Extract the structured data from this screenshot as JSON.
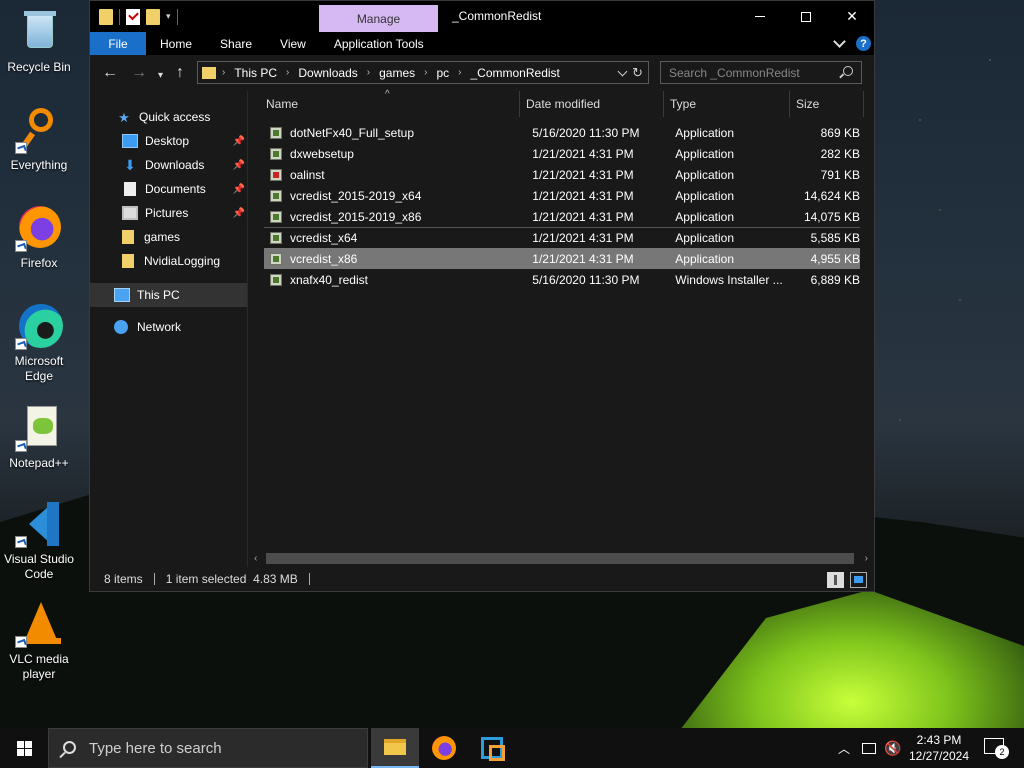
{
  "desktop": {
    "icons": [
      {
        "label": "Recycle Bin"
      },
      {
        "label": "Everything"
      },
      {
        "label": "Firefox"
      },
      {
        "label": "Microsoft Edge"
      },
      {
        "label": "Notepad++"
      },
      {
        "label": "Visual Studio Code"
      },
      {
        "label": "VLC media player"
      }
    ]
  },
  "window": {
    "title": "_CommonRedist",
    "manage_tab": "Manage",
    "ribbon_tabs": [
      "File",
      "Home",
      "Share",
      "View",
      "Application Tools"
    ],
    "help_label": "?",
    "breadcrumbs": [
      "This PC",
      "Downloads",
      "games",
      "pc",
      "_CommonRedist"
    ],
    "search_placeholder": "Search _CommonRedist"
  },
  "nav": {
    "items": [
      {
        "label": "Quick access"
      },
      {
        "label": "Desktop"
      },
      {
        "label": "Downloads"
      },
      {
        "label": "Documents"
      },
      {
        "label": "Pictures"
      },
      {
        "label": "games"
      },
      {
        "label": "NvidiaLogging"
      },
      {
        "label": "This PC"
      },
      {
        "label": "Network"
      }
    ]
  },
  "files": {
    "columns": [
      "Name",
      "Date modified",
      "Type",
      "Size"
    ],
    "rows": [
      {
        "name": "dotNetFx40_Full_setup",
        "date": "5/16/2020 11:30 PM",
        "type": "Application",
        "size": "869 KB"
      },
      {
        "name": "dxwebsetup",
        "date": "1/21/2021 4:31 PM",
        "type": "Application",
        "size": "282 KB"
      },
      {
        "name": "oalinst",
        "date": "1/21/2021 4:31 PM",
        "type": "Application",
        "size": "791 KB"
      },
      {
        "name": "vcredist_2015-2019_x64",
        "date": "1/21/2021 4:31 PM",
        "type": "Application",
        "size": "14,624 KB"
      },
      {
        "name": "vcredist_2015-2019_x86",
        "date": "1/21/2021 4:31 PM",
        "type": "Application",
        "size": "14,075 KB"
      },
      {
        "name": "vcredist_x64",
        "date": "1/21/2021 4:31 PM",
        "type": "Application",
        "size": "5,585 KB"
      },
      {
        "name": "vcredist_x86",
        "date": "1/21/2021 4:31 PM",
        "type": "Application",
        "size": "4,955 KB"
      },
      {
        "name": "xnafx40_redist",
        "date": "5/16/2020 11:30 PM",
        "type": "Windows Installer ...",
        "size": "6,889 KB"
      }
    ]
  },
  "status": {
    "item_count": "8 items",
    "selection": "1 item selected  4.83 MB"
  },
  "taskbar": {
    "search_placeholder": "Type here to search",
    "time": "2:43 PM",
    "date": "12/27/2024",
    "notification_count": "2"
  }
}
